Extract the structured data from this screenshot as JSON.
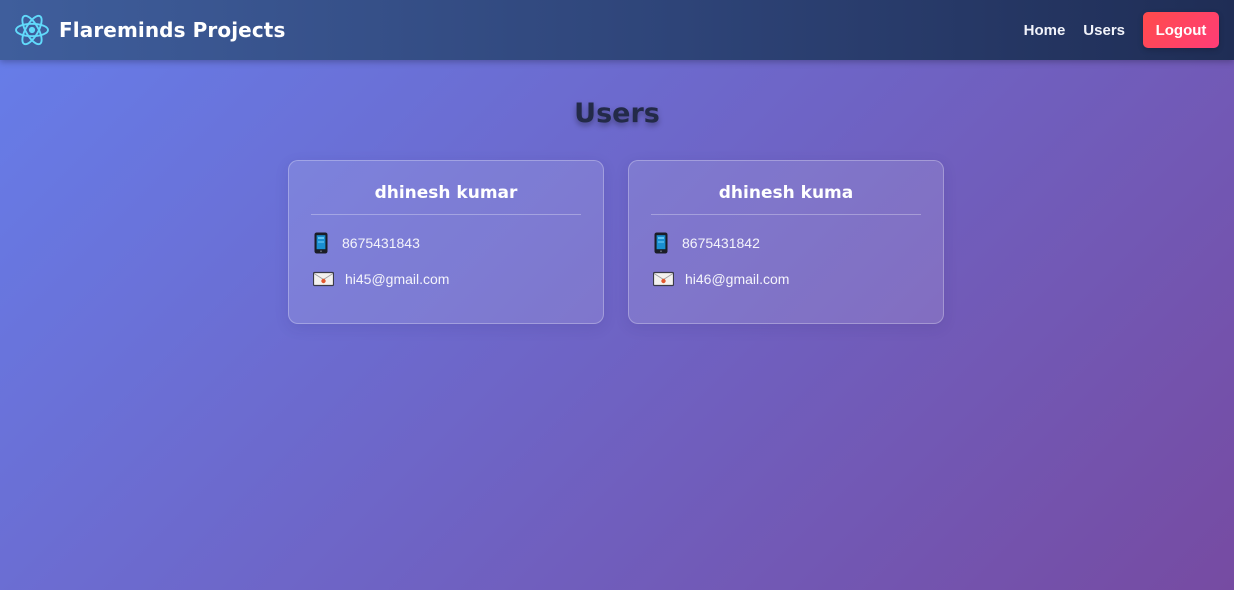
{
  "navbar": {
    "brand_icon": "react-atom-icon",
    "brand_title": "Flareminds Projects",
    "links": [
      "Home",
      "Users"
    ],
    "logout_label": "Logout"
  },
  "page": {
    "title": "Users"
  },
  "users": [
    {
      "name": "dhinesh kumar",
      "phone_icon": "mobile-phone-icon",
      "phone": "8675431843",
      "email_icon": "envelope-icon",
      "email": "hi45@gmail.com"
    },
    {
      "name": "dhinesh kuma",
      "phone_icon": "mobile-phone-icon",
      "phone": "8675431842",
      "email_icon": "envelope-icon",
      "email": "hi46@gmail.com"
    }
  ],
  "colors": {
    "background_start": "#667eea",
    "background_end": "#764ba2",
    "navbar": "#2e4478",
    "logout": "#ff4b4b",
    "react_logo": "#61dafb"
  }
}
